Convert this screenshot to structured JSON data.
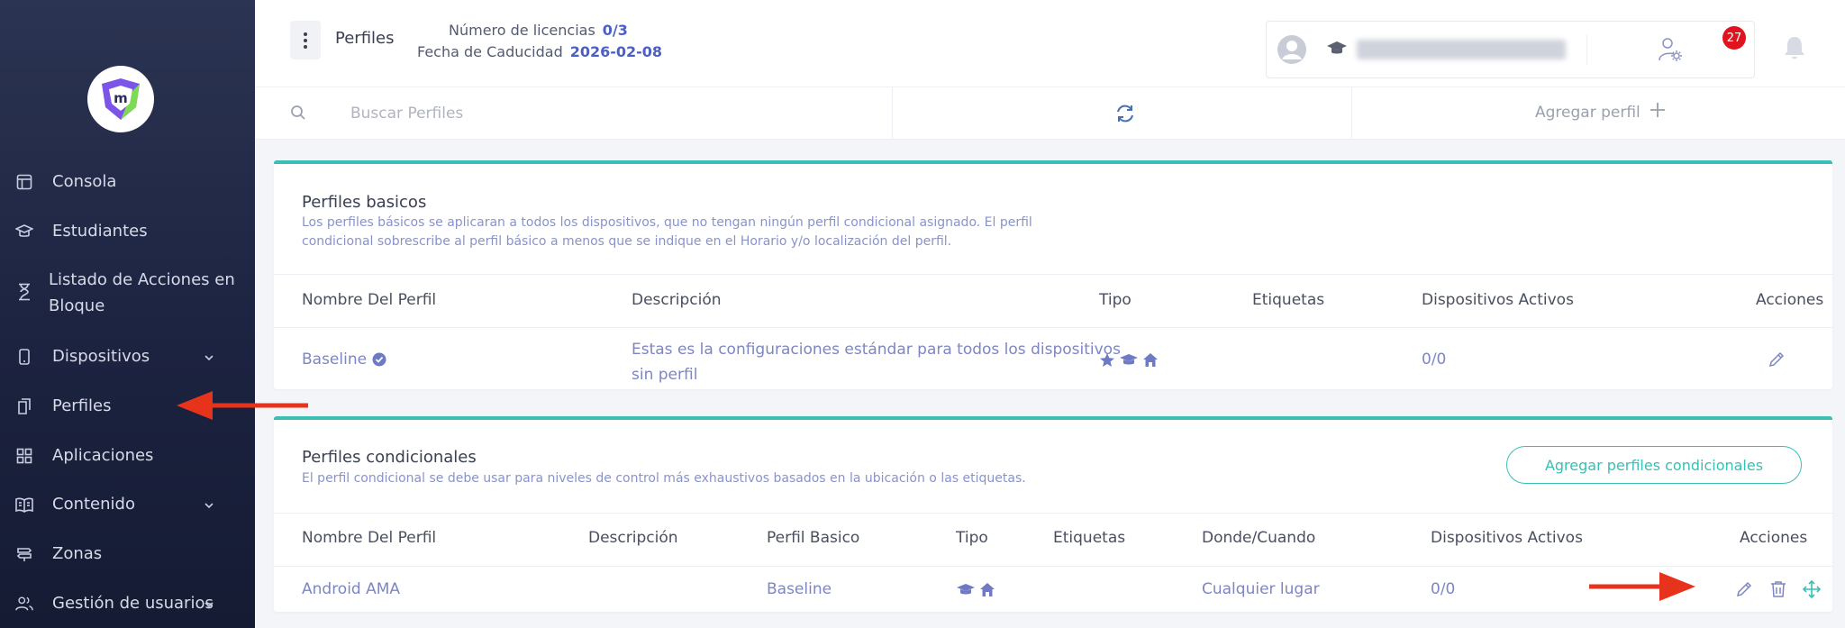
{
  "sidebar": {
    "items": [
      {
        "label": "Consola",
        "icon": "layout-icon"
      },
      {
        "label": "Estudiantes",
        "icon": "graduation-cap-icon"
      },
      {
        "label": "Listado de Acciones en",
        "label2": "Bloque",
        "icon": "hourglass-icon"
      },
      {
        "label": "Dispositivos",
        "icon": "phone-icon"
      },
      {
        "label": "Perfiles",
        "icon": "files-icon"
      },
      {
        "label": "Aplicaciones",
        "icon": "apps-grid-icon"
      },
      {
        "label": "Contenido",
        "icon": "book-icon"
      },
      {
        "label": "Zonas",
        "icon": "signpost-icon"
      },
      {
        "label": "Gestión de usuarios",
        "icon": "users-icon"
      }
    ]
  },
  "header": {
    "title": "Perfiles",
    "licenses_label": "Número de licencias",
    "licenses_value": "0/3",
    "expiry_label": "Fecha de Caducidad",
    "expiry_value": "2026-02-08",
    "notifications_count": "27"
  },
  "toolbar": {
    "search_placeholder": "Buscar Perfiles",
    "add_profile_label": "Agregar perfil"
  },
  "basic_profiles": {
    "title": "Perfiles basicos",
    "description_line1": "Los perfiles básicos se aplicaran a todos los dispositivos, que no tengan ningún perfil condicional asignado. El perfil",
    "description_line2": "condicional sobrescribe al perfil básico a menos que se indique en el Horario y/o localización del perfil.",
    "columns": [
      "Nombre Del Perfil",
      "Descripción",
      "Tipo",
      "Etiquetas",
      "Dispositivos Activos",
      "Acciones"
    ],
    "rows": [
      {
        "name": "Baseline",
        "description_line1": "Estas es la configuraciones estándar para todos los dispositivos",
        "description_line2": "sin perfil",
        "active_devices": "0/0"
      }
    ]
  },
  "conditional_profiles": {
    "title": "Perfiles condicionales",
    "description": "El perfil condicional se debe usar para niveles de control más exhaustivos basados en la ubicación o las etiquetas.",
    "add_button_label": "Agregar perfiles condicionales",
    "columns": [
      "Nombre Del Perfil",
      "Descripción",
      "Perfil Basico",
      "Tipo",
      "Etiquetas",
      "Donde/Cuando",
      "Dispositivos Activos",
      "Acciones"
    ],
    "rows": [
      {
        "name": "Android AMA",
        "description": "",
        "basic_profile": "Baseline",
        "where_when": "Cualquier lugar",
        "active_devices": "0/0"
      }
    ]
  },
  "colors": {
    "accent": "#39bfb4",
    "link": "#7d86c2",
    "arrow": "#e8331c",
    "badge": "#e0141e"
  }
}
